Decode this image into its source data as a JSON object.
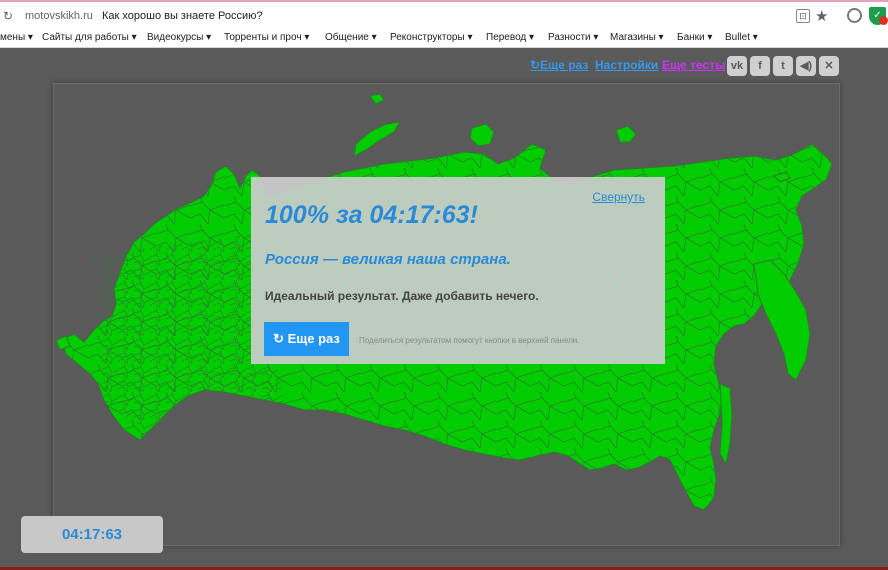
{
  "browser": {
    "domain": "motovskikh.ru",
    "page_title": "Как хорошо вы знаете Россию?",
    "bookmarks": [
      "мены",
      "Сайты для работы",
      "Видеокурсы",
      "Торренты и проч",
      "Общение",
      "Реконструкторы",
      "Перевод",
      "Разности",
      "Магазины",
      "Банки",
      "Bullet"
    ]
  },
  "toolbar": {
    "again": "↻Еще раз",
    "settings": "Настройки",
    "more_tests": "Еще тесты",
    "share_icons": [
      "vk-icon",
      "facebook-icon",
      "twitter-icon",
      "sound-icon",
      "close-icon"
    ]
  },
  "result": {
    "collapse": "Свернуть",
    "title": "100% за 04:17:63!",
    "subtitle": "Россия — великая наша страна.",
    "text": "Идеальный результат. Даже добавить нечего.",
    "retry_label": "↻ Еще раз",
    "share_hint": "Поделиться результатом помогут кнопки в верхней панели."
  },
  "timer": "04:17:63",
  "colors": {
    "map_fill": "#00cc00",
    "accent_blue": "#2a8ad8",
    "link_violet": "#cc33ff",
    "background": "#5a5a5a"
  }
}
